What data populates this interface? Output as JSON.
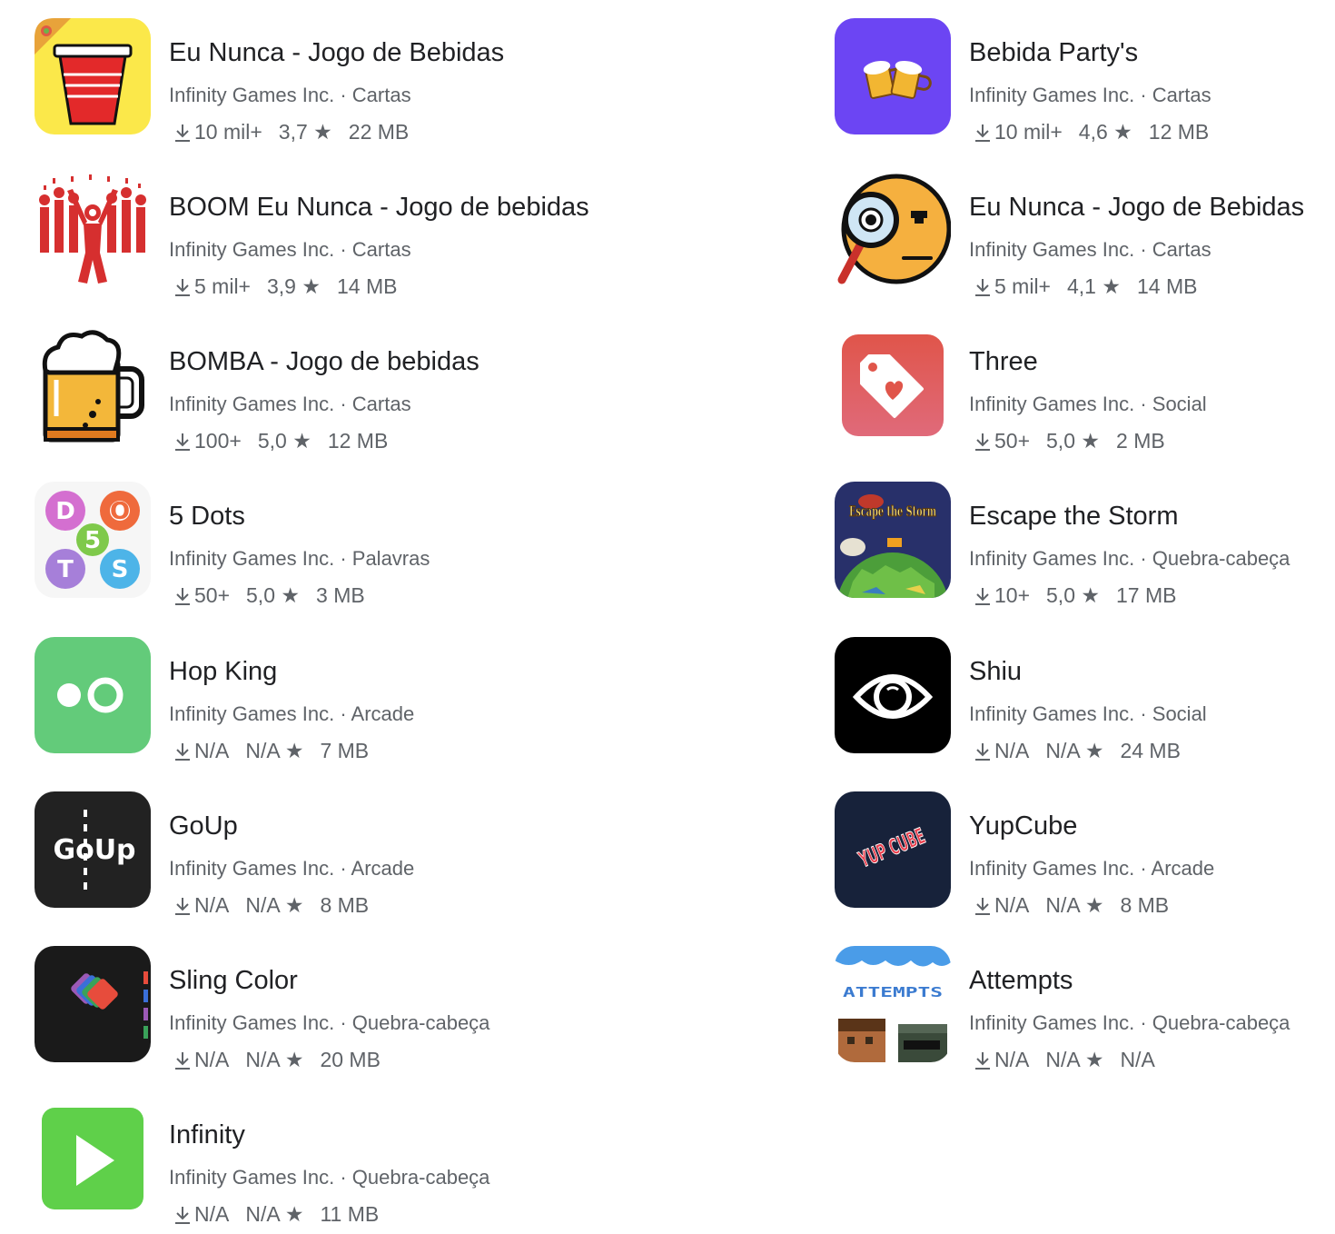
{
  "apps": [
    {
      "title": "Eu Nunca - Jogo de Bebidas",
      "developer": "Infinity Games Inc.",
      "category": "Cartas",
      "downloads": "10 mil+",
      "rating": "3,7",
      "size": "22 MB",
      "icon": "red-cup-icon"
    },
    {
      "title": "Bebida Party's",
      "developer": "Infinity Games Inc.",
      "category": "Cartas",
      "downloads": "10 mil+",
      "rating": "4,6",
      "size": "12 MB",
      "icon": "beer-mugs-icon"
    },
    {
      "title": "BOOM Eu Nunca - Jogo de bebidas",
      "developer": "Infinity Games Inc.",
      "category": "Cartas",
      "downloads": "5 mil+",
      "rating": "3,9",
      "size": "14 MB",
      "icon": "party-crowd-icon"
    },
    {
      "title": "Eu Nunca - Jogo de Bebidas",
      "developer": "Infinity Games Inc.",
      "category": "Cartas",
      "downloads": "5 mil+",
      "rating": "4,1",
      "size": "14 MB",
      "icon": "magnifier-face-icon"
    },
    {
      "title": "BOMBA - Jogo de bebidas",
      "developer": "Infinity Games Inc.",
      "category": "Cartas",
      "downloads": "100+",
      "rating": "5,0",
      "size": "12 MB",
      "icon": "beer-mug-icon"
    },
    {
      "title": "Three",
      "developer": "Infinity Games Inc.",
      "category": "Social",
      "downloads": "50+",
      "rating": "5,0",
      "size": "2 MB",
      "icon": "heart-tag-icon"
    },
    {
      "title": "5 Dots",
      "developer": "Infinity Games Inc.",
      "category": "Palavras",
      "downloads": "50+",
      "rating": "5,0",
      "size": "3 MB",
      "icon": "letter-dots-icon",
      "icon_letters": [
        "D",
        "O",
        "5",
        "T",
        "S"
      ]
    },
    {
      "title": "Escape the Storm",
      "developer": "Infinity Games Inc.",
      "category": "Quebra-cabeça",
      "downloads": "10+",
      "rating": "5,0",
      "size": "17 MB",
      "icon": "storm-planet-icon",
      "icon_text": "Escape the Storm"
    },
    {
      "title": "Hop King",
      "developer": "Infinity Games Inc.",
      "category": "Arcade",
      "downloads": "N/A",
      "rating": "N/A",
      "size": "7 MB",
      "icon": "two-dots-icon"
    },
    {
      "title": "Shiu",
      "developer": "Infinity Games Inc.",
      "category": "Social",
      "downloads": "N/A",
      "rating": "N/A",
      "size": "24 MB",
      "icon": "eye-icon"
    },
    {
      "title": "GoUp",
      "developer": "Infinity Games Inc.",
      "category": "Arcade",
      "downloads": "N/A",
      "rating": "N/A",
      "size": "8 MB",
      "icon": "goup-logo-icon",
      "icon_text": "GoUp"
    },
    {
      "title": "YupCube",
      "developer": "Infinity Games Inc.",
      "category": "Arcade",
      "downloads": "N/A",
      "rating": "N/A",
      "size": "8 MB",
      "icon": "yupcube-logo-icon",
      "icon_text": "YUP CUBE"
    },
    {
      "title": "Sling Color",
      "developer": "Infinity Games Inc.",
      "category": "Quebra-cabeça",
      "downloads": "N/A",
      "rating": "N/A",
      "size": "20 MB",
      "icon": "color-cards-icon"
    },
    {
      "title": "Attempts",
      "developer": "Infinity Games Inc.",
      "category": "Quebra-cabeça",
      "downloads": "N/A",
      "rating": "N/A",
      "size": "N/A",
      "icon": "pixel-characters-icon",
      "icon_text": "ATTEMPTS"
    },
    {
      "title": "Infinity",
      "developer": "Infinity Games Inc.",
      "category": "Quebra-cabeça",
      "downloads": "N/A",
      "rating": "N/A",
      "size": "11 MB",
      "icon": "play-button-icon"
    }
  ],
  "separator": "·",
  "star": "★"
}
